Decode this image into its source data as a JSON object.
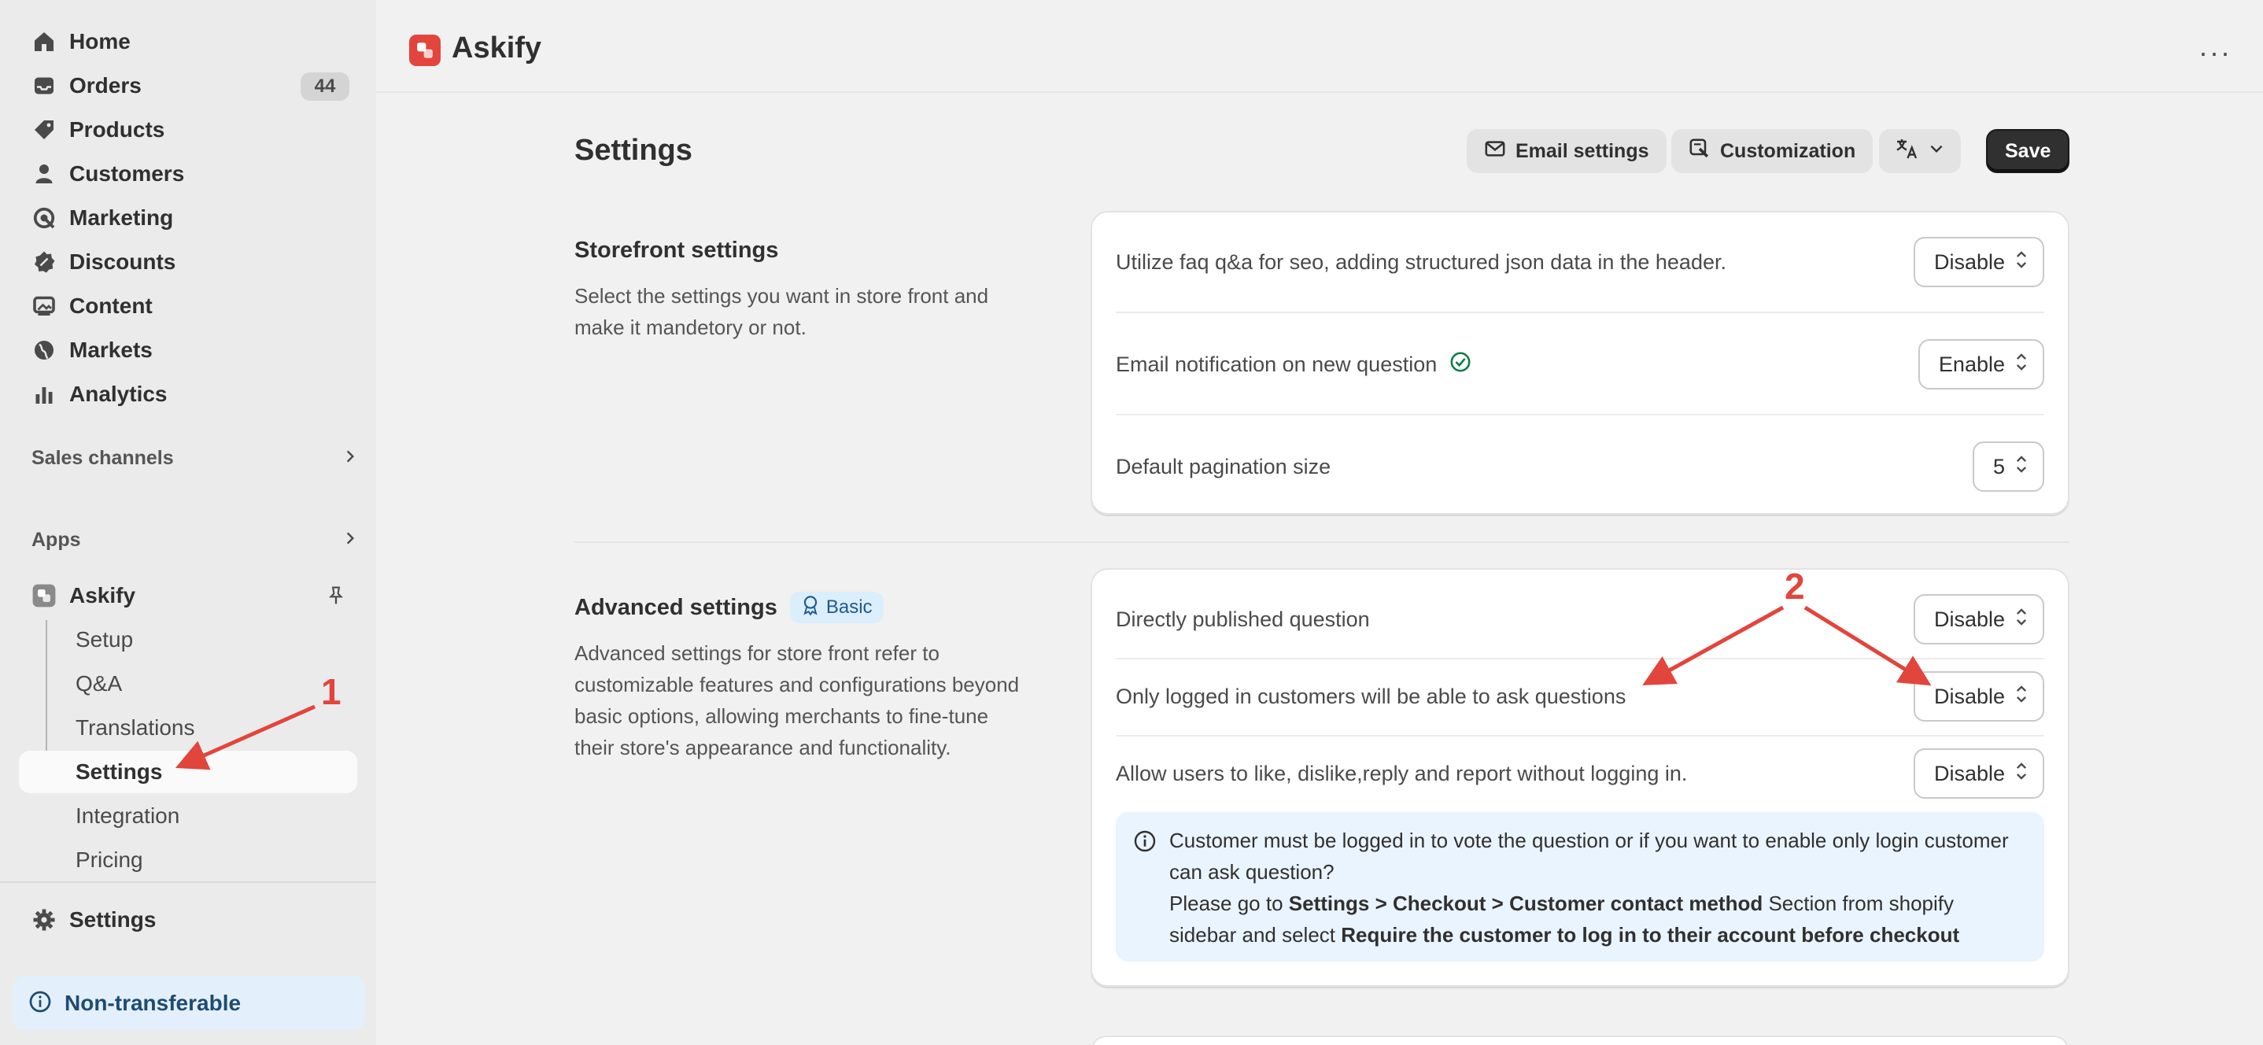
{
  "sidebar": {
    "items": [
      {
        "label": "Home",
        "icon": "home-icon"
      },
      {
        "label": "Orders",
        "icon": "inbox-icon",
        "badge": "44"
      },
      {
        "label": "Products",
        "icon": "tag-icon"
      },
      {
        "label": "Customers",
        "icon": "person-icon"
      },
      {
        "label": "Marketing",
        "icon": "target-icon"
      },
      {
        "label": "Discounts",
        "icon": "discount-icon"
      },
      {
        "label": "Content",
        "icon": "image-icon"
      },
      {
        "label": "Markets",
        "icon": "globe-icon"
      },
      {
        "label": "Analytics",
        "icon": "bar-chart-icon"
      }
    ],
    "sales_channels": "Sales channels",
    "apps": "Apps",
    "app": {
      "name": "Askify",
      "sub_items": [
        "Setup",
        "Q&A",
        "Translations",
        "Settings",
        "Integration",
        "Pricing"
      ]
    },
    "settings": "Settings",
    "non_transferable": "Non-transferable"
  },
  "topbar": {
    "app_title": "Askify",
    "more": "···"
  },
  "page": {
    "title": "Settings",
    "actions": {
      "email_settings": "Email settings",
      "customization": "Customization",
      "save": "Save"
    }
  },
  "storefront": {
    "title": "Storefront settings",
    "description": "Select the settings you want in store front and make it mandetory or not.",
    "rows": [
      {
        "label": "Utilize faq q&a for seo, adding structured json data in the header.",
        "value": "Disable"
      },
      {
        "label": "Email notification on new question",
        "value": "Enable"
      },
      {
        "label": "Default pagination size",
        "value": "5"
      }
    ]
  },
  "advanced": {
    "title": "Advanced settings",
    "badge": "Basic",
    "description": "Advanced settings for store front refer to customizable features and configurations beyond basic options, allowing merchants to fine-tune their store's appearance and functionality.",
    "rows": [
      {
        "label": "Directly published question",
        "value": "Disable"
      },
      {
        "label": "Only logged in customers will be able to ask questions",
        "value": "Disable"
      },
      {
        "label": "Allow users to like, dislike,reply and report without logging in.",
        "value": "Disable"
      }
    ],
    "info": {
      "line1": "Customer must be logged in to vote the question or if you want to enable only login customer can ask question?",
      "line2_prefix": "Please go to ",
      "line2_bold": "Settings > Checkout > Customer contact method",
      "line2_mid": " Section from shopify sidebar and select ",
      "line2_bold2": "Require the customer to log in to their account before checkout"
    }
  },
  "annotations": {
    "one": "1",
    "two": "2"
  },
  "colors": {
    "accent_red": "#e2453c",
    "info_blue": "#eaf4ff",
    "badge_blue": "#daeefc",
    "success_green": "#0c7a43"
  }
}
